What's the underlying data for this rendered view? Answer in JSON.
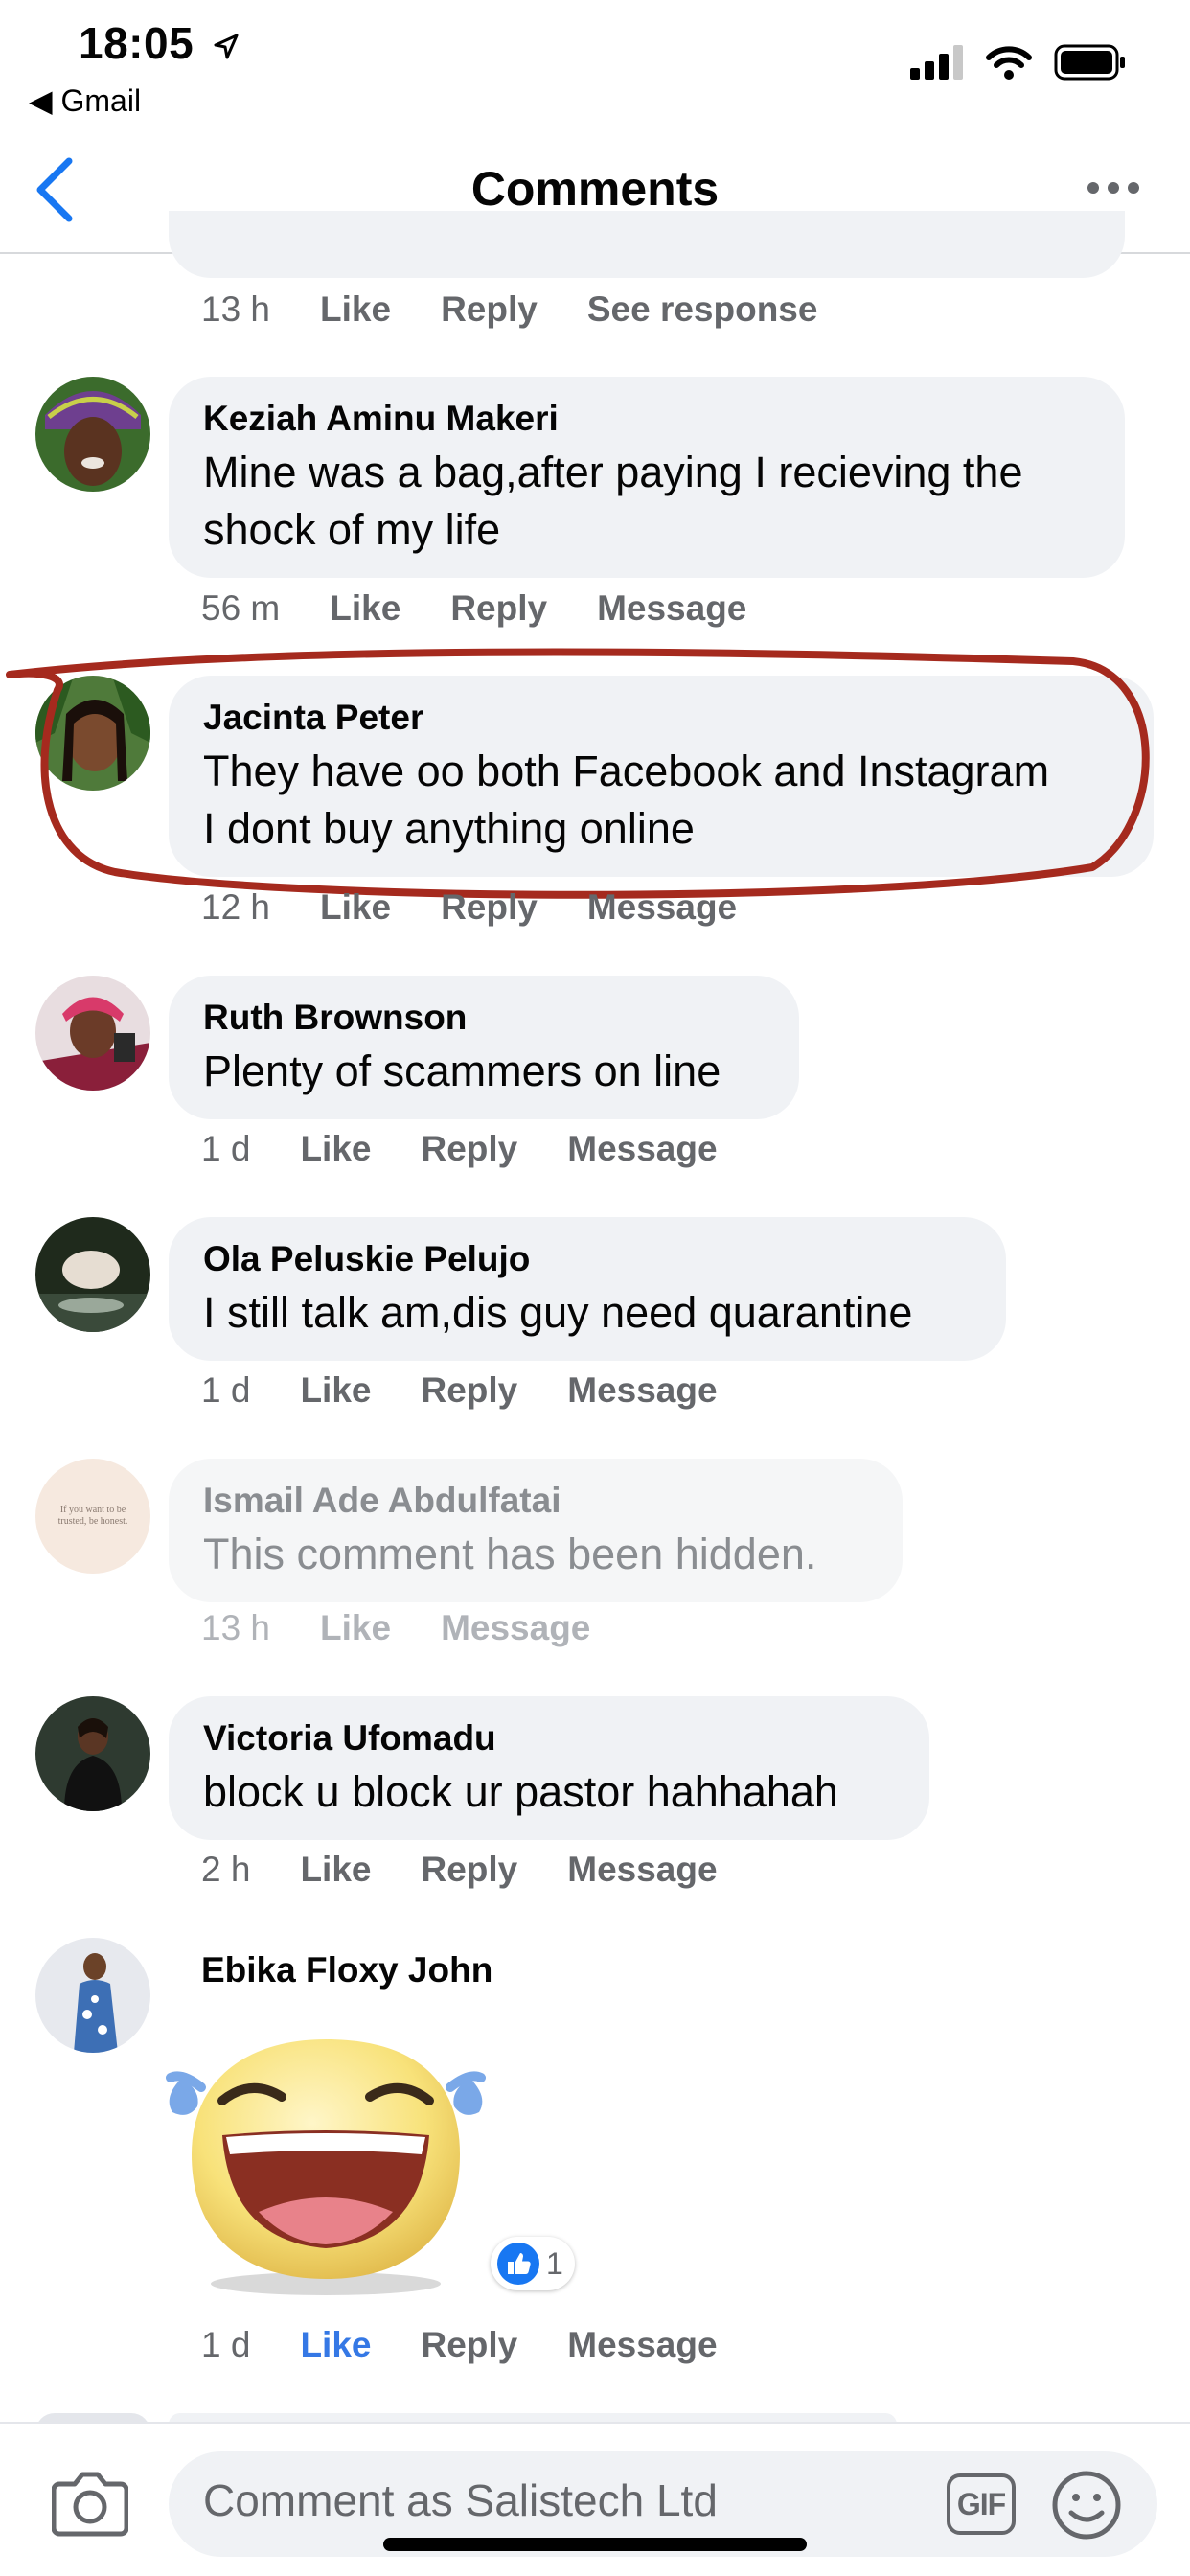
{
  "status_bar": {
    "time": "18:05",
    "back_app": "◀ Gmail"
  },
  "header": {
    "title": "Comments"
  },
  "top_meta": {
    "time": "13 h",
    "like": "Like",
    "reply": "Reply",
    "see_response": "See response"
  },
  "comments": [
    {
      "author": "Keziah Aminu Makeri",
      "text_line1": "Mine was a bag,after paying I recieving the",
      "text_line2": "shock of my life",
      "time": "56 m",
      "like": "Like",
      "reply": "Reply",
      "message": "Message"
    },
    {
      "author": "Jacinta Peter",
      "text_line1": "They have oo both Facebook and Instagram",
      "text_line2": "I dont buy anything online",
      "time": "12 h",
      "like": "Like",
      "reply": "Reply",
      "message": "Message"
    },
    {
      "author": "Ruth Brownson",
      "text": "Plenty of scammers on line",
      "time": "1 d",
      "like": "Like",
      "reply": "Reply",
      "message": "Message"
    },
    {
      "author": "Ola Peluskie Pelujo",
      "text": "I still talk am,dis guy need quarantine",
      "time": "1 d",
      "like": "Like",
      "reply": "Reply",
      "message": "Message"
    },
    {
      "author": "Ismail Ade Abdulfatai",
      "text": "This comment has been hidden.",
      "avatar_text": "If you want to be trusted, be honest.",
      "time": "13 h",
      "like": "Like",
      "message": "Message"
    },
    {
      "author": "Victoria Ufomadu",
      "text": "block u block ur pastor hahhahah",
      "time": "2 h",
      "like": "Like",
      "reply": "Reply",
      "message": "Message"
    },
    {
      "author": "Ebika Floxy John",
      "reaction_count": "1",
      "time": "1 d",
      "like": "Like",
      "reply": "Reply",
      "message": "Message"
    }
  ],
  "composer": {
    "placeholder": "Comment as Salistech Ltd",
    "gif_label": "GIF"
  },
  "colors": {
    "accent": "#3578e5",
    "bubble": "#f0f2f5",
    "annotation": "#a52a1e"
  }
}
